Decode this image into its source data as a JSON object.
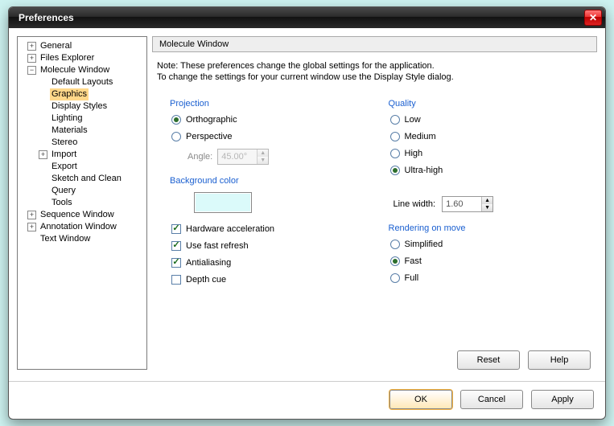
{
  "window": {
    "title": "Preferences"
  },
  "tree": {
    "n0": "General",
    "n1": "Files Explorer",
    "n2": "Molecule Window",
    "n2a": "Default Layouts",
    "n2b": "Graphics",
    "n2c": "Display Styles",
    "n2d": "Lighting",
    "n2e": "Materials",
    "n2f": "Stereo",
    "n2g": "Import",
    "n2h": "Export",
    "n2i": "Sketch and Clean",
    "n2j": "Query",
    "n2k": "Tools",
    "n3": "Sequence Window",
    "n4": "Annotation Window",
    "n5": "Text Window"
  },
  "header": {
    "title": "Molecule Window"
  },
  "note": {
    "line1": "Note: These preferences change the global settings for the application.",
    "line2": "To change the settings for your current window use the Display Style dialog."
  },
  "projection": {
    "label": "Projection",
    "orthographic": "Orthographic",
    "perspective": "Perspective",
    "selected": "orthographic",
    "angle_label": "Angle:",
    "angle_value": "45.00°"
  },
  "bgcolor": {
    "label": "Background color",
    "hex": "#dbfafa"
  },
  "checks": {
    "hw": {
      "label": "Hardware acceleration",
      "on": true
    },
    "ufr": {
      "label": "Use fast refresh",
      "on": true
    },
    "aa": {
      "label": "Antialiasing",
      "on": true
    },
    "dc": {
      "label": "Depth cue",
      "on": false
    }
  },
  "quality": {
    "label": "Quality",
    "low": "Low",
    "medium": "Medium",
    "high": "High",
    "ultra": "Ultra-high",
    "selected": "ultra"
  },
  "linewidth": {
    "label": "Line width:",
    "value": "1.60"
  },
  "rom": {
    "label": "Rendering on move",
    "simplified": "Simplified",
    "fast": "Fast",
    "full": "Full",
    "selected": "fast"
  },
  "buttons": {
    "reset": "Reset",
    "help": "Help",
    "ok": "OK",
    "cancel": "Cancel",
    "apply": "Apply"
  }
}
